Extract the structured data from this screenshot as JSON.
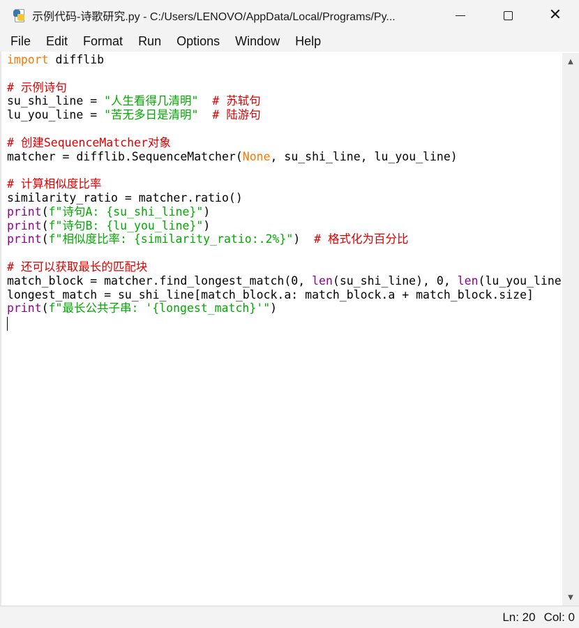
{
  "window": {
    "title": "示例代码-诗歌研究.py - C:/Users/LENOVO/AppData/Local/Programs/Py...",
    "controls": {
      "minimize": "—",
      "maximize": "☐",
      "close": "✕"
    }
  },
  "menu": {
    "items": [
      "File",
      "Edit",
      "Format",
      "Run",
      "Options",
      "Window",
      "Help"
    ]
  },
  "code": {
    "lines": [
      [
        {
          "t": "import",
          "c": "kw"
        },
        {
          "t": " difflib"
        }
      ],
      [],
      [
        {
          "t": "# 示例诗句",
          "c": "cm"
        }
      ],
      [
        {
          "t": "su_shi_line = "
        },
        {
          "t": "\"人生看得几清明\"",
          "c": "st"
        },
        {
          "t": "  "
        },
        {
          "t": "# 苏轼句",
          "c": "cm"
        }
      ],
      [
        {
          "t": "lu_you_line = "
        },
        {
          "t": "\"苦无多日是清明\"",
          "c": "st"
        },
        {
          "t": "  "
        },
        {
          "t": "# 陆游句",
          "c": "cm"
        }
      ],
      [],
      [
        {
          "t": "# 创建SequenceMatcher对象",
          "c": "cm"
        }
      ],
      [
        {
          "t": "matcher = difflib.SequenceMatcher("
        },
        {
          "t": "None",
          "c": "kw"
        },
        {
          "t": ", su_shi_line, lu_you_line)"
        }
      ],
      [],
      [
        {
          "t": "# 计算相似度比率",
          "c": "cm"
        }
      ],
      [
        {
          "t": "similarity_ratio = matcher.ratio()"
        }
      ],
      [
        {
          "t": "print",
          "c": "bi"
        },
        {
          "t": "("
        },
        {
          "t": "f\"诗句A: {su_shi_line}\"",
          "c": "st"
        },
        {
          "t": ")"
        }
      ],
      [
        {
          "t": "print",
          "c": "bi"
        },
        {
          "t": "("
        },
        {
          "t": "f\"诗句B: {lu_you_line}\"",
          "c": "st"
        },
        {
          "t": ")"
        }
      ],
      [
        {
          "t": "print",
          "c": "bi"
        },
        {
          "t": "("
        },
        {
          "t": "f\"相似度比率: {similarity_ratio:.2%}\"",
          "c": "st"
        },
        {
          "t": ")  "
        },
        {
          "t": "# 格式化为百分比",
          "c": "cm"
        }
      ],
      [],
      [
        {
          "t": "# 还可以获取最长的匹配块",
          "c": "cm"
        }
      ],
      [
        {
          "t": "match_block = matcher.find_longest_match(0, "
        },
        {
          "t": "len",
          "c": "bi"
        },
        {
          "t": "(su_shi_line), 0, "
        },
        {
          "t": "len",
          "c": "bi"
        },
        {
          "t": "(lu_you_line"
        }
      ],
      [
        {
          "t": "longest_match = su_shi_line[match_block.a: match_block.a + match_block.size]"
        }
      ],
      [
        {
          "t": "print",
          "c": "bi"
        },
        {
          "t": "("
        },
        {
          "t": "f\"最长公共子串: '{longest_match}'\"",
          "c": "st"
        },
        {
          "t": ")"
        }
      ]
    ]
  },
  "status": {
    "line": "Ln: 20",
    "column": "Col: 0"
  },
  "colors": {
    "keyword": "#ff7700",
    "builtin": "#900090",
    "comment": "#dd0000",
    "string": "#00aa00"
  }
}
